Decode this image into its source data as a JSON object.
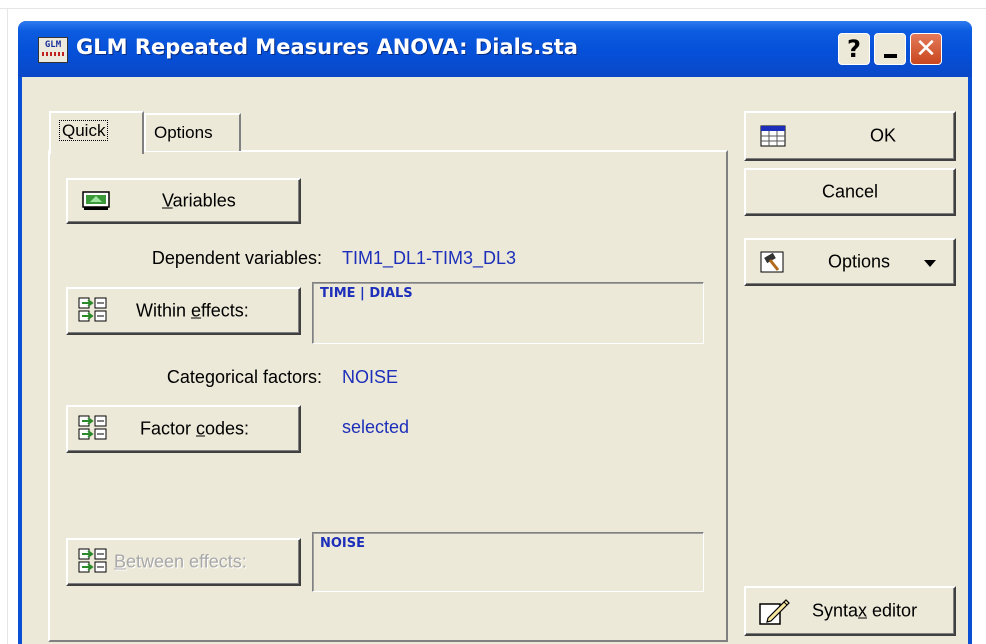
{
  "window": {
    "title": "GLM Repeated Measures ANOVA: Dials.sta",
    "app_icon_text": "GLM",
    "help_label": "?",
    "close_label": "✕"
  },
  "tabs": [
    {
      "label": "Quick",
      "active": true
    },
    {
      "label": "Options",
      "active": false
    }
  ],
  "quick": {
    "variables_button": {
      "mnemonic": "V",
      "rest": "ariables"
    },
    "dependent_label": "Dependent variables:",
    "dependent_value": "TIM1_DL1-TIM3_DL3",
    "within_button": {
      "pre": "Within ",
      "mnemonic": "e",
      "post": "ffects:"
    },
    "within_value": "TIME | DIALS",
    "categorical_label": "Categorical factors:",
    "categorical_value": "NOISE",
    "factor_codes_button": {
      "pre": "Factor ",
      "mnemonic": "c",
      "post": "odes:"
    },
    "factor_codes_value": "selected",
    "between_button": {
      "pre": "",
      "mnemonic": "B",
      "post": "etween effects:",
      "disabled": true
    },
    "between_value": "NOISE"
  },
  "side": {
    "ok_label": "OK",
    "cancel_label": "Cancel",
    "options_label": "Options",
    "syntax_button": {
      "pre": "Synta",
      "mnemonic": "x",
      "post": " editor"
    }
  },
  "colors": {
    "titlebar": "#0550d8",
    "dialog_bg": "#ece9d8",
    "value_text": "#1d2fba",
    "close_button": "#c8461e"
  },
  "icons": [
    "glm-app-icon",
    "help-icon",
    "minimize-icon",
    "close-icon",
    "variables-icon",
    "effects-icon",
    "ok-table-icon",
    "options-hammer-icon",
    "dropdown-arrow-icon",
    "syntax-editor-icon"
  ]
}
